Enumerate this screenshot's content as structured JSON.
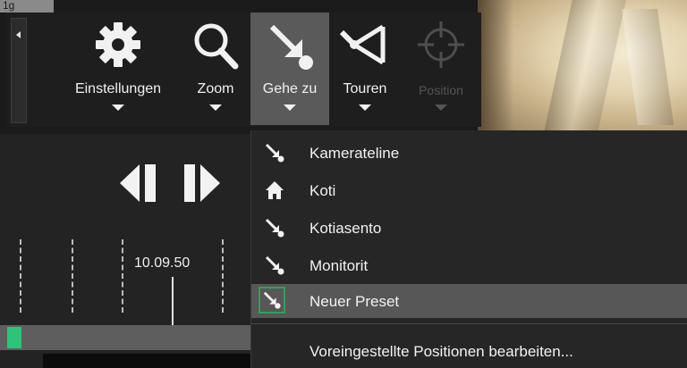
{
  "topstrip": {
    "text": "1g"
  },
  "toolbar": {
    "buttons": [
      {
        "label": "Einstellungen",
        "icon": "gear-icon"
      },
      {
        "label": "Zoom",
        "icon": "magnifier-icon"
      },
      {
        "label": "Gehe zu",
        "icon": "goto-arrow-icon",
        "active": true
      },
      {
        "label": "Touren",
        "icon": "tour-icon"
      },
      {
        "label": "Position",
        "icon": "crosshair-icon",
        "disabled": true
      }
    ]
  },
  "timeline": {
    "time_label": "10.09.50"
  },
  "menu": {
    "items": [
      {
        "label": "Kamerateline",
        "icon": "goto-arrow-icon"
      },
      {
        "label": "Koti",
        "icon": "home-icon"
      },
      {
        "label": "Kotiasento",
        "icon": "goto-arrow-icon"
      },
      {
        "label": "Monitorit",
        "icon": "goto-arrow-icon"
      },
      {
        "label": "Neuer Preset",
        "icon": "goto-arrow-icon",
        "selected": true
      }
    ],
    "edit_label": "Voreingestellte Positionen bearbeiten..."
  },
  "colors": {
    "selection_border": "#2fa05a",
    "timeline_marker": "#2ec27a",
    "active_button": "#5a5a5a"
  }
}
